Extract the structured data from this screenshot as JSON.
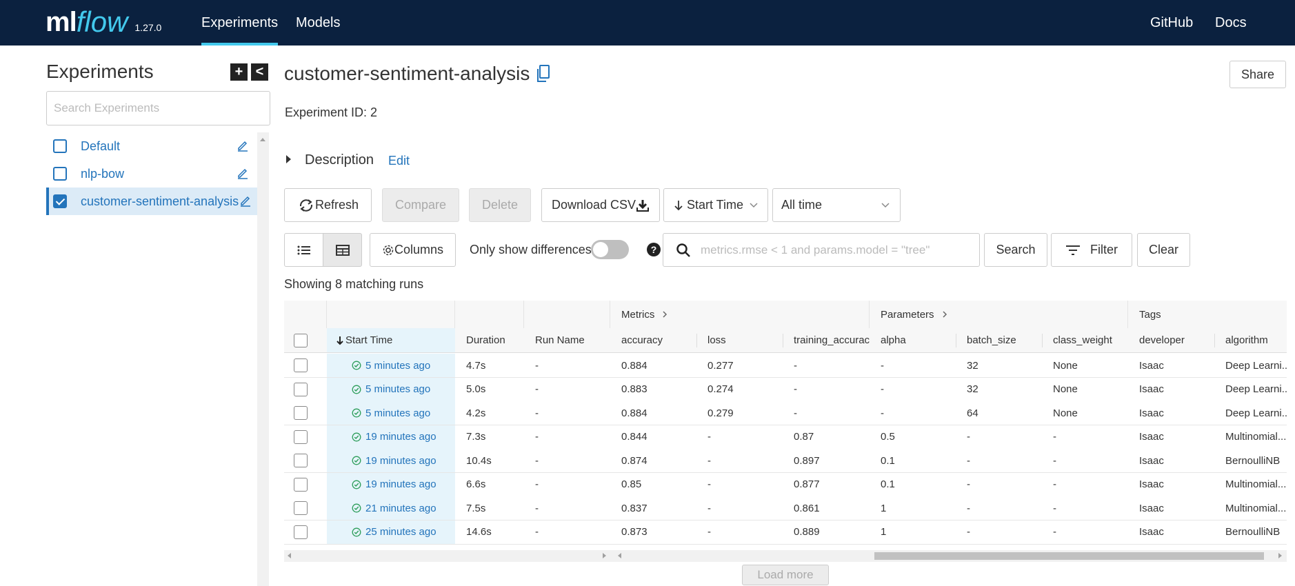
{
  "nav": {
    "logo_ml": "ml",
    "logo_flow": "flow",
    "version": "1.27.0",
    "experiments": "Experiments",
    "models": "Models",
    "github": "GitHub",
    "docs": "Docs"
  },
  "sidebar": {
    "title": "Experiments",
    "add_button": "+",
    "collapse_button": "<",
    "search_placeholder": "Search Experiments",
    "items": [
      {
        "label": "Default",
        "checked": false
      },
      {
        "label": "nlp-bow",
        "checked": false
      },
      {
        "label": "customer-sentiment-analysis",
        "checked": true
      }
    ]
  },
  "experiment": {
    "title": "customer-sentiment-analysis",
    "share": "Share",
    "id_text": "Experiment ID:  2",
    "description": "Description",
    "edit": "Edit"
  },
  "toolbar": {
    "refresh": "Refresh",
    "compare": "Compare",
    "delete": "Delete",
    "download_csv": "Download CSV",
    "sort": "Start Time",
    "time_range": "All time",
    "columns": "Columns",
    "only_diff": "Only show differences",
    "help": "?",
    "search_placeholder": "metrics.rmse < 1 and params.model = \"tree\"",
    "search": "Search",
    "filter": "Filter",
    "clear": "Clear"
  },
  "showing": "Showing 8 matching runs",
  "table": {
    "groups": {
      "metrics": "Metrics",
      "parameters": "Parameters",
      "tags": "Tags"
    },
    "headers": {
      "start_time": "Start Time",
      "duration": "Duration",
      "run_name": "Run Name",
      "accuracy": "accuracy",
      "loss": "loss",
      "training_accuracy": "training_accurac",
      "alpha": "alpha",
      "batch_size": "batch_size",
      "class_weight": "class_weight",
      "developer": "developer",
      "algorithm": "algorithm"
    },
    "rows": [
      {
        "start": "5 minutes ago",
        "duration": "4.7s",
        "run_name": "-",
        "accuracy": "0.884",
        "loss": "0.277",
        "train_acc": "-",
        "alpha": "-",
        "batch": "32",
        "class_weight": "None",
        "developer": "Isaac",
        "algorithm": "Deep Learni..."
      },
      {
        "start": "5 minutes ago",
        "duration": "5.0s",
        "run_name": "-",
        "accuracy": "0.883",
        "loss": "0.274",
        "train_acc": "-",
        "alpha": "-",
        "batch": "32",
        "class_weight": "None",
        "developer": "Isaac",
        "algorithm": "Deep Learni..."
      },
      {
        "start": "5 minutes ago",
        "duration": "4.2s",
        "run_name": "-",
        "accuracy": "0.884",
        "loss": "0.279",
        "train_acc": "-",
        "alpha": "-",
        "batch": "64",
        "class_weight": "None",
        "developer": "Isaac",
        "algorithm": "Deep Learni..."
      },
      {
        "start": "19 minutes ago",
        "duration": "7.3s",
        "run_name": "-",
        "accuracy": "0.844",
        "loss": "-",
        "train_acc": "0.87",
        "alpha": "0.5",
        "batch": "-",
        "class_weight": "-",
        "developer": "Isaac",
        "algorithm": "Multinomial..."
      },
      {
        "start": "19 minutes ago",
        "duration": "10.4s",
        "run_name": "-",
        "accuracy": "0.874",
        "loss": "-",
        "train_acc": "0.897",
        "alpha": "0.1",
        "batch": "-",
        "class_weight": "-",
        "developer": "Isaac",
        "algorithm": "BernoulliNB"
      },
      {
        "start": "19 minutes ago",
        "duration": "6.6s",
        "run_name": "-",
        "accuracy": "0.85",
        "loss": "-",
        "train_acc": "0.877",
        "alpha": "0.1",
        "batch": "-",
        "class_weight": "-",
        "developer": "Isaac",
        "algorithm": "Multinomial..."
      },
      {
        "start": "21 minutes ago",
        "duration": "7.5s",
        "run_name": "-",
        "accuracy": "0.837",
        "loss": "-",
        "train_acc": "0.861",
        "alpha": "1",
        "batch": "-",
        "class_weight": "-",
        "developer": "Isaac",
        "algorithm": "Multinomial..."
      },
      {
        "start": "25 minutes ago",
        "duration": "14.6s",
        "run_name": "-",
        "accuracy": "0.873",
        "loss": "-",
        "train_acc": "0.889",
        "alpha": "1",
        "batch": "-",
        "class_weight": "-",
        "developer": "Isaac",
        "algorithm": "BernoulliNB"
      }
    ]
  },
  "load_more": "Load more",
  "colors": {
    "nav_bg": "#0b213f",
    "accent": "#43c9ed",
    "link": "#2374bb",
    "success": "#2e9e5b"
  }
}
